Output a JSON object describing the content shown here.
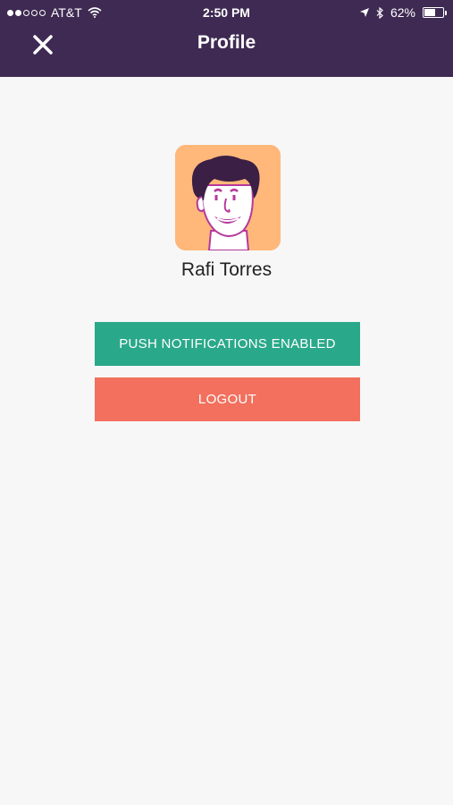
{
  "status_bar": {
    "carrier": "AT&T",
    "time": "2:50 PM",
    "battery": "62%",
    "battery_level": 0.62
  },
  "header": {
    "title": "Profile",
    "close_icon": "close-icon",
    "background": "#3e2a52"
  },
  "profile": {
    "name": "Rafi Torres",
    "avatar_icon": "avatar-illustration"
  },
  "actions": {
    "push_label": "PUSH NOTIFICATIONS ENABLED",
    "push_color": "#2aa88a",
    "logout_label": "LOGOUT",
    "logout_color": "#f2705d"
  }
}
